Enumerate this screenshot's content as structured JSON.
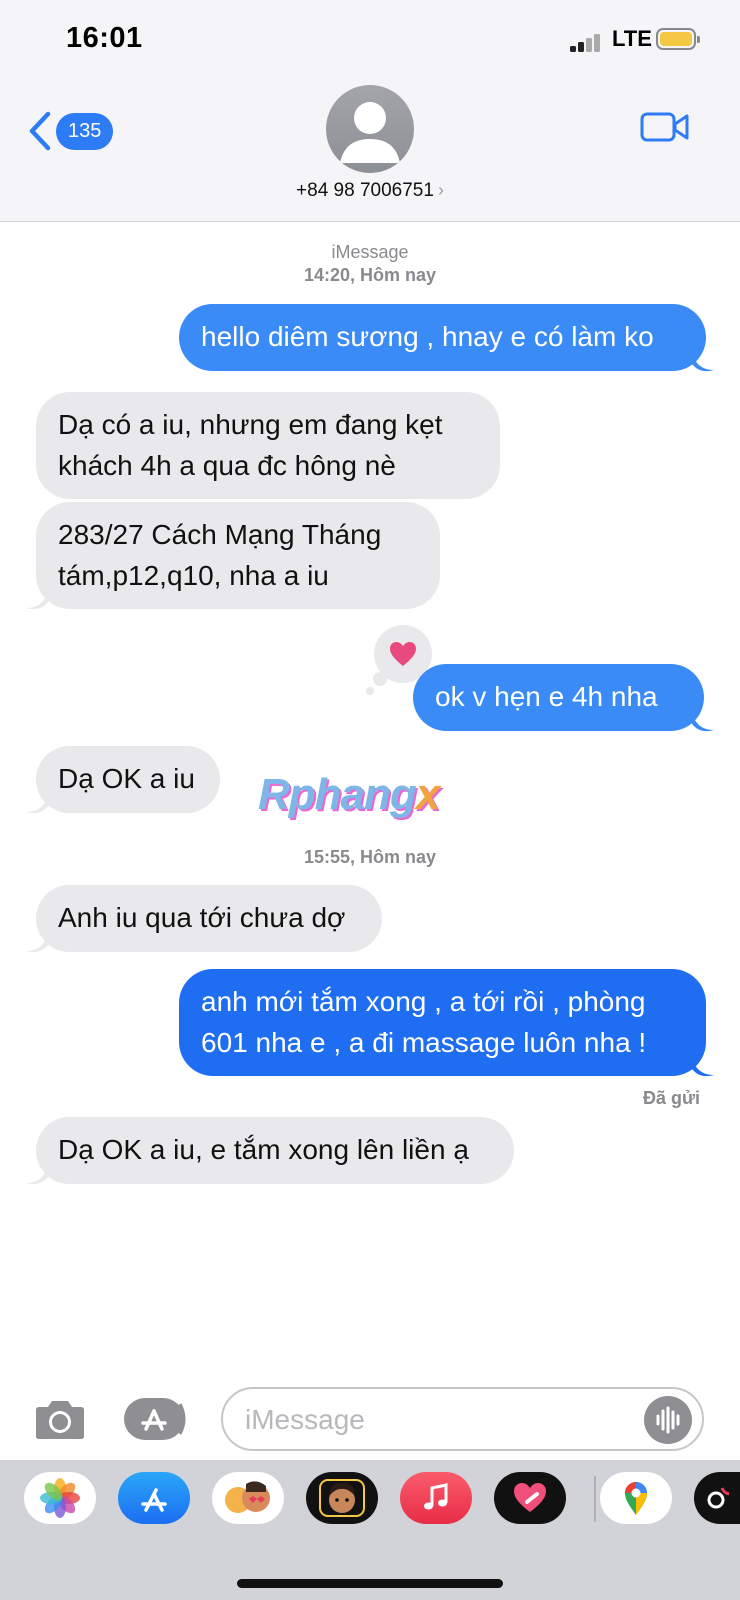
{
  "status_bar": {
    "time": "16:01",
    "network": "LTE"
  },
  "header": {
    "back_count": "135",
    "contact": "+84 98 7006751",
    "contact_chevron": "›"
  },
  "thread": {
    "meta1_service": "iMessage",
    "meta1_time": "14:20, Hôm nay",
    "meta2_time": "15:55, Hôm nay",
    "messages": [
      {
        "dir": "sent",
        "text": "hello diêm sương , hnay e có làm ko"
      },
      {
        "dir": "received",
        "text": "Dạ có a iu, nhưng em đang kẹt khách 4h a qua đc hông nè"
      },
      {
        "dir": "received",
        "text": "283/27 Cách Mạng Tháng tám,p12,q10, nha a iu"
      },
      {
        "dir": "sent",
        "text": "ok v hẹn e 4h nha",
        "reaction": "heart"
      },
      {
        "dir": "received",
        "text": "Dạ OK a iu"
      },
      {
        "dir": "received",
        "text": "Anh iu qua tới chưa dợ"
      },
      {
        "dir": "sent",
        "text": "anh mới tắm xong , a tới rồi , phòng 601 nha e , a đi massage luôn nha !"
      },
      {
        "dir": "received",
        "text": "Dạ OK a iu, e tắm xong lên liền ạ"
      }
    ],
    "delivered": "Đã gửi"
  },
  "watermark": {
    "main": "Rphang",
    "accent": "x"
  },
  "composer": {
    "placeholder": "iMessage"
  },
  "app_tray": [
    "photos-icon",
    "app-store-icon",
    "memoji-stickers-icon",
    "memoji-icon",
    "music-icon",
    "digital-touch-icon",
    "google-maps-icon",
    "tiktok-icon"
  ],
  "colors": {
    "sent": "#3b8bf7",
    "received": "#e9e9eb",
    "accent": "#2d7cf6"
  }
}
